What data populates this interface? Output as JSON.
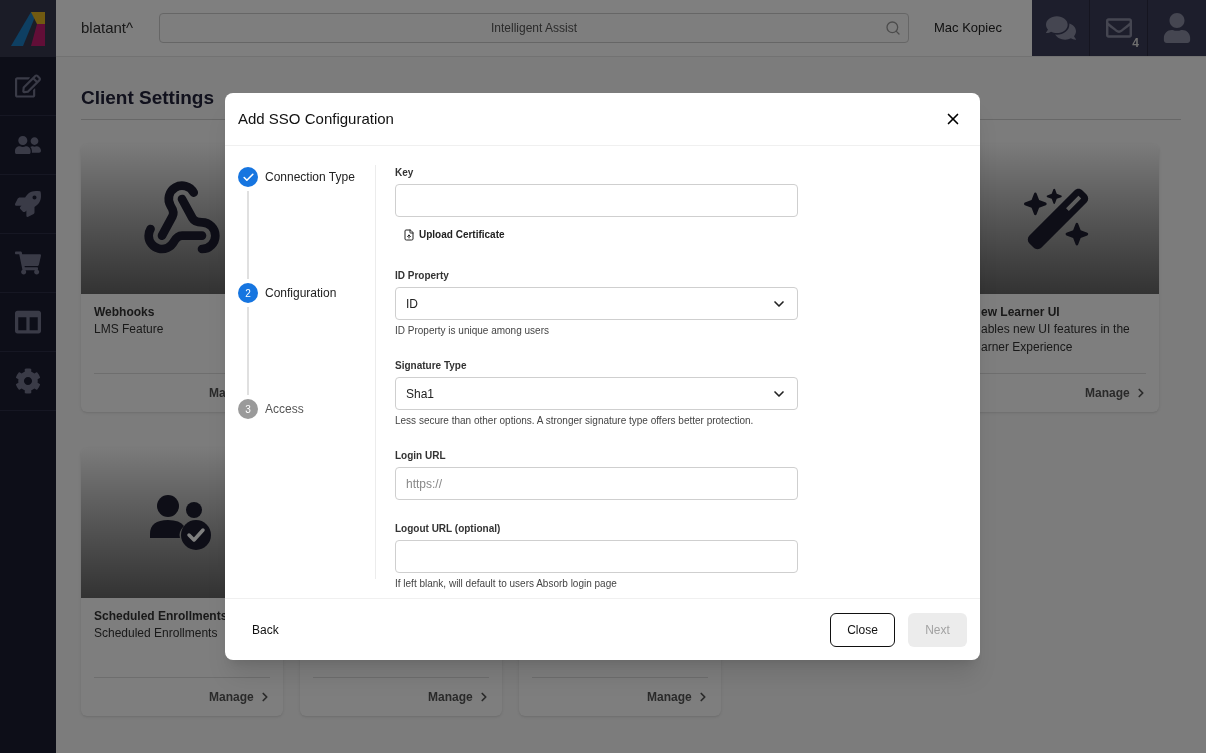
{
  "header": {
    "brand": "blatant^",
    "search": {
      "placeholder": "Intelligent Assist"
    },
    "user_name": "Mac Kopiec",
    "mail_count": "4"
  },
  "page": {
    "title": "Client Settings",
    "card_rows": [
      [
        {
          "title": "Webhooks",
          "description": "LMS Feature",
          "action": "Ma",
          "truncated": true,
          "kind": "webhook"
        },
        {
          "title": "ew Learner UI",
          "description": "ables new UI features in the\narner Experience",
          "action": "Manage",
          "truncated": false,
          "kind": "wand"
        }
      ],
      [
        {
          "title": "Scheduled Enrollments",
          "description": "Scheduled Enrollments",
          "action": "Manage",
          "truncated": false,
          "kind": "users"
        },
        {
          "action": "Manage",
          "truncated": false,
          "kind": "hidden"
        },
        {
          "action": "Manage",
          "truncated": false,
          "kind": "hidden"
        }
      ]
    ]
  },
  "dialog": {
    "title": "Add SSO Configuration",
    "steps": [
      {
        "label": "Connection Type",
        "kind": "done"
      },
      {
        "label": "Configuration",
        "number": "2",
        "kind": "current"
      },
      {
        "label": "Access",
        "number": "3",
        "kind": "upcoming"
      }
    ],
    "fields": [
      {
        "kind": "text",
        "label": "Key"
      },
      {
        "kind": "upload",
        "label": "Upload Certificate"
      },
      {
        "kind": "select",
        "label": "ID Property",
        "value": "ID",
        "help": "ID Property is unique among users"
      },
      {
        "kind": "select",
        "label": "Signature Type",
        "value": "Sha1",
        "help": "Less secure than other options. A stronger signature type offers better protection."
      },
      {
        "kind": "text",
        "label": "Login URL",
        "placeholder": "https://"
      },
      {
        "kind": "text",
        "label": "Logout URL (optional)",
        "help": "If left blank, will default to users Absorb login page"
      }
    ],
    "back": "Back",
    "close": "Close",
    "next": {
      "label": "Next",
      "disabled": true
    }
  }
}
